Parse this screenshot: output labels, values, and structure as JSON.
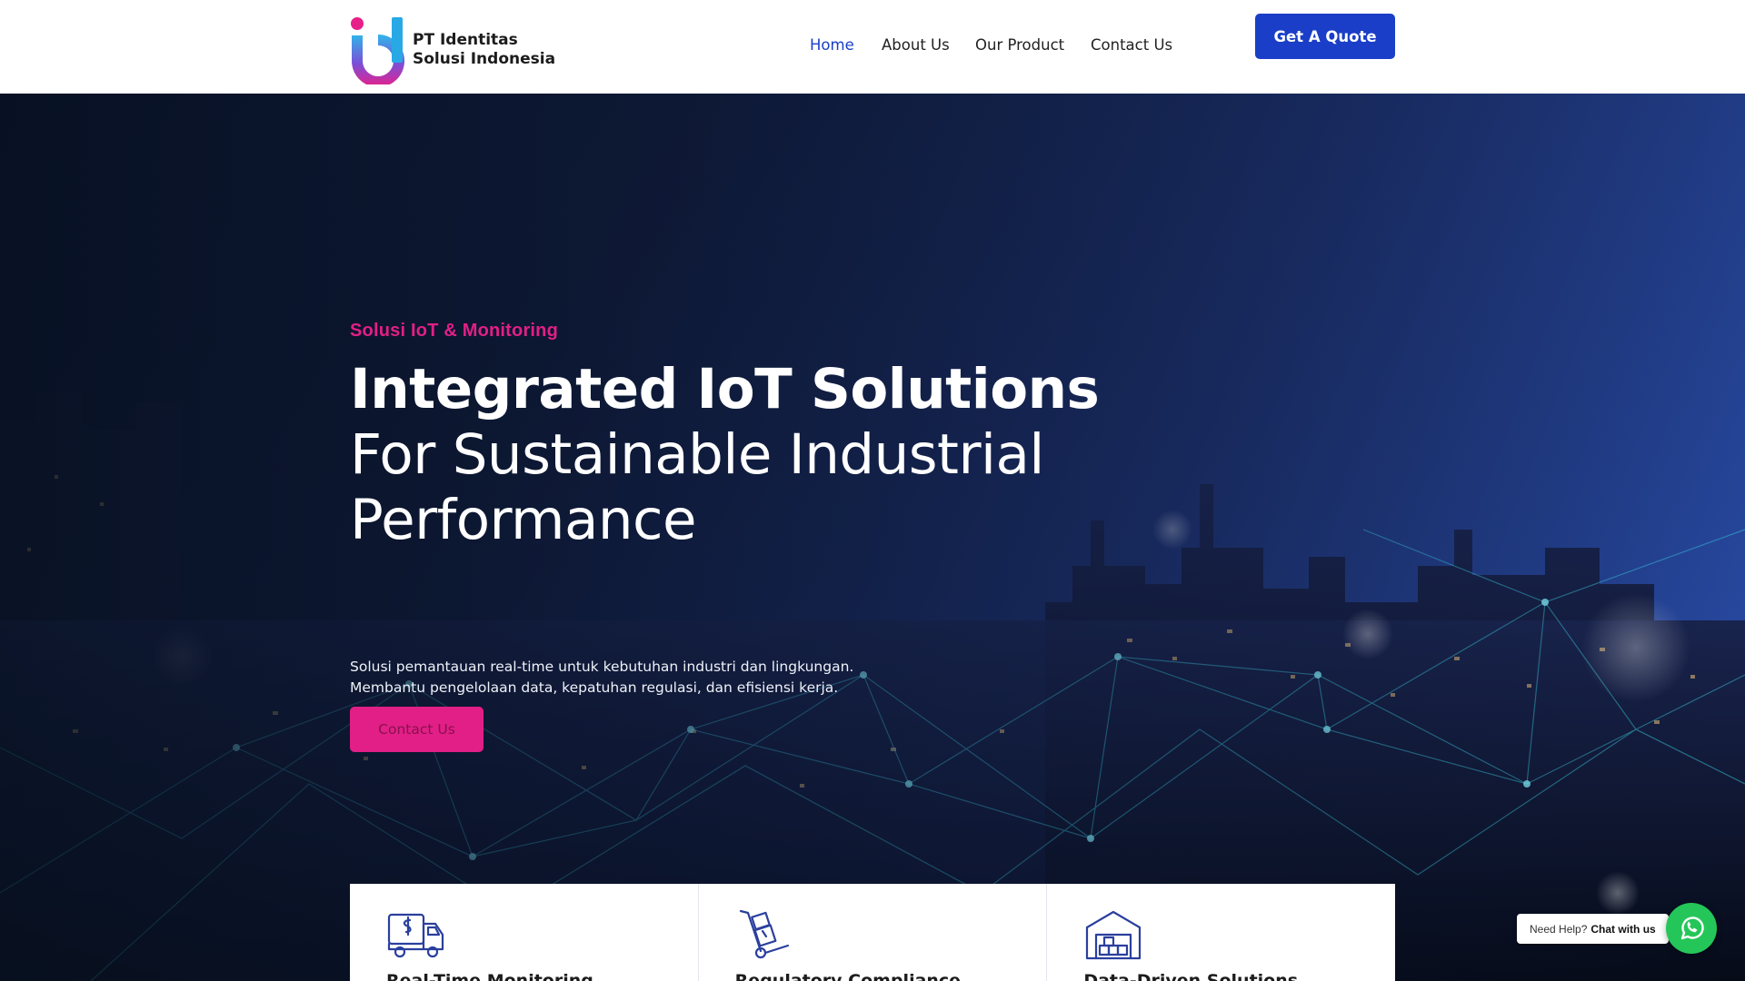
{
  "brand": {
    "name_line1": "PT Identitas",
    "name_line2": "Solusi Indonesia",
    "logo_icon": "id-logo-mark",
    "colors": {
      "primary": "#1a3ec7",
      "accent": "#e11f86",
      "logo_cyan": "#28a9e6"
    }
  },
  "nav": {
    "items": [
      {
        "label": "Home",
        "active": true
      },
      {
        "label": "About Us",
        "active": false
      },
      {
        "label": "Our Product",
        "active": false
      },
      {
        "label": "Contact Us",
        "active": false
      }
    ],
    "cta_label": "Get A Quote"
  },
  "hero": {
    "eyebrow": "Solusi IoT & Monitoring",
    "headline_line1": "Integrated IoT Solutions",
    "headline_line2": "For Sustainable Industrial",
    "headline_line3": "Performance",
    "description_line1": "Solusi pemantauan real-time untuk kebutuhan industri dan lingkungan.",
    "description_line2": "Membantu pengelolaan data, kepatuhan regulasi, dan efisiensi kerja.",
    "button_label": "Contact Us",
    "background": "night city skyline with network lines"
  },
  "features": [
    {
      "icon": "delivery-truck-dollar-icon",
      "title": "Real-Time Monitoring"
    },
    {
      "icon": "hand-truck-boxes-icon",
      "title": "Regulatory Compliance"
    },
    {
      "icon": "warehouse-icon",
      "title": "Data-Driven Solutions"
    }
  ],
  "chat": {
    "prompt": "Need Help?",
    "action": "Chat with us",
    "icon": "whatsapp-icon"
  }
}
